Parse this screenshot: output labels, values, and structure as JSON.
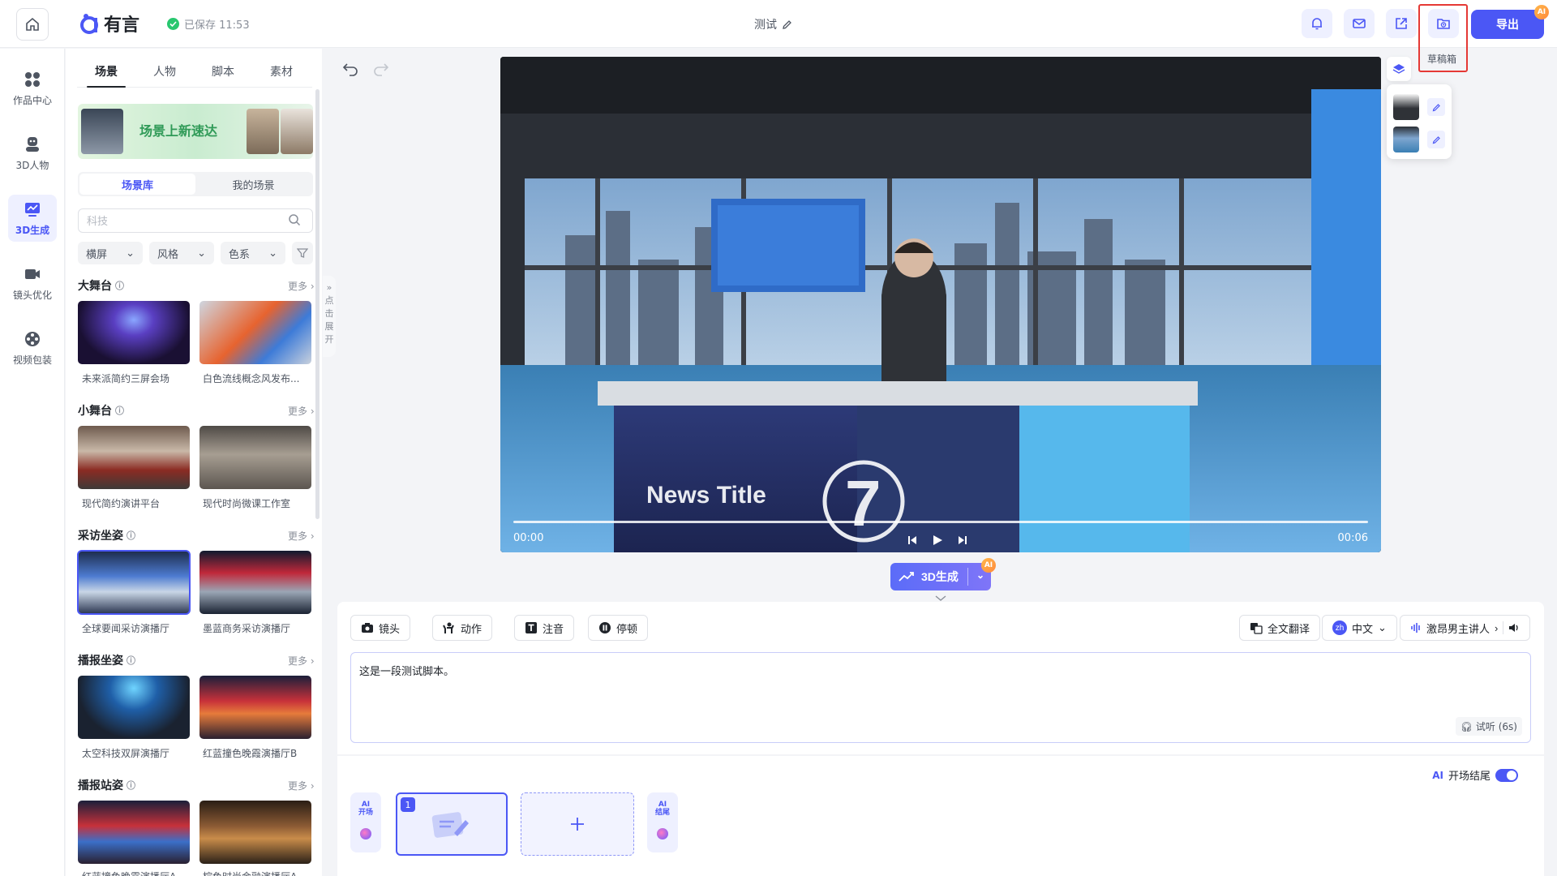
{
  "header": {
    "logo_text": "有言",
    "saved_status": "已保存 11:53",
    "doc_title": "测试",
    "draft_label": "草稿箱",
    "export_label": "导出",
    "ai_badge": "AI"
  },
  "leftnav": {
    "items": [
      {
        "label": "作品中心",
        "icon": "grid-icon"
      },
      {
        "label": "3D人物",
        "icon": "avatar-icon"
      },
      {
        "label": "3D生成",
        "icon": "chart-icon"
      },
      {
        "label": "镜头优化",
        "icon": "camera-icon"
      },
      {
        "label": "视频包装",
        "icon": "film-reel-icon"
      }
    ],
    "active": "3D生成"
  },
  "panel": {
    "tabs": [
      "场景",
      "人物",
      "脚本",
      "素材"
    ],
    "active_tab": "场景",
    "banner_text": "场景上新速达",
    "segment": [
      "场景库",
      "我的场景"
    ],
    "search_value": "",
    "search_placeholder": "科技",
    "filters": [
      "横屏",
      "风格",
      "色系"
    ],
    "more_label": "更多",
    "collapse_label": [
      "点",
      "击",
      "展",
      "开"
    ],
    "sections": [
      {
        "title": "大舞台",
        "items": [
          "未来派简约三屏会场",
          "白色流线概念风发布..."
        ]
      },
      {
        "title": "小舞台",
        "items": [
          "现代简约演讲平台",
          "现代时尚微课工作室"
        ]
      },
      {
        "title": "采访坐姿",
        "items": [
          "全球要闻采访演播厅",
          "墨蓝商务采访演播厅"
        ]
      },
      {
        "title": "播报坐姿",
        "items": [
          "太空科技双屏演播厅",
          "红蓝撞色晚霞演播厅B"
        ]
      },
      {
        "title": "播报站姿",
        "items": [
          "红蓝撞色晚霞演播厅A",
          "棕色时尚金融演播厅A"
        ]
      }
    ]
  },
  "video": {
    "time_current": "00:00",
    "time_total": "00:06",
    "progress": 0,
    "desk_text": "News  Title",
    "desk_number": "7"
  },
  "generate": {
    "label": "3D生成",
    "badge": "AI"
  },
  "editor": {
    "tools": [
      "镜头",
      "动作",
      "注音",
      "停顿"
    ],
    "translate": "全文翻译",
    "lang_code": "zh",
    "lang": "中文",
    "voice": "激昂男主讲人",
    "script": "这是一段测试脚本。",
    "listen": "试听 (6s)"
  },
  "timeline": {
    "toggle_label": "开场结尾",
    "ai_open": [
      "AI",
      "开场"
    ],
    "ai_close": [
      "AI",
      "结尾"
    ],
    "clip_number": "1"
  },
  "colors": {
    "accent": "#4b57f5",
    "highlight": "#e53935",
    "saved": "#28c76f"
  }
}
